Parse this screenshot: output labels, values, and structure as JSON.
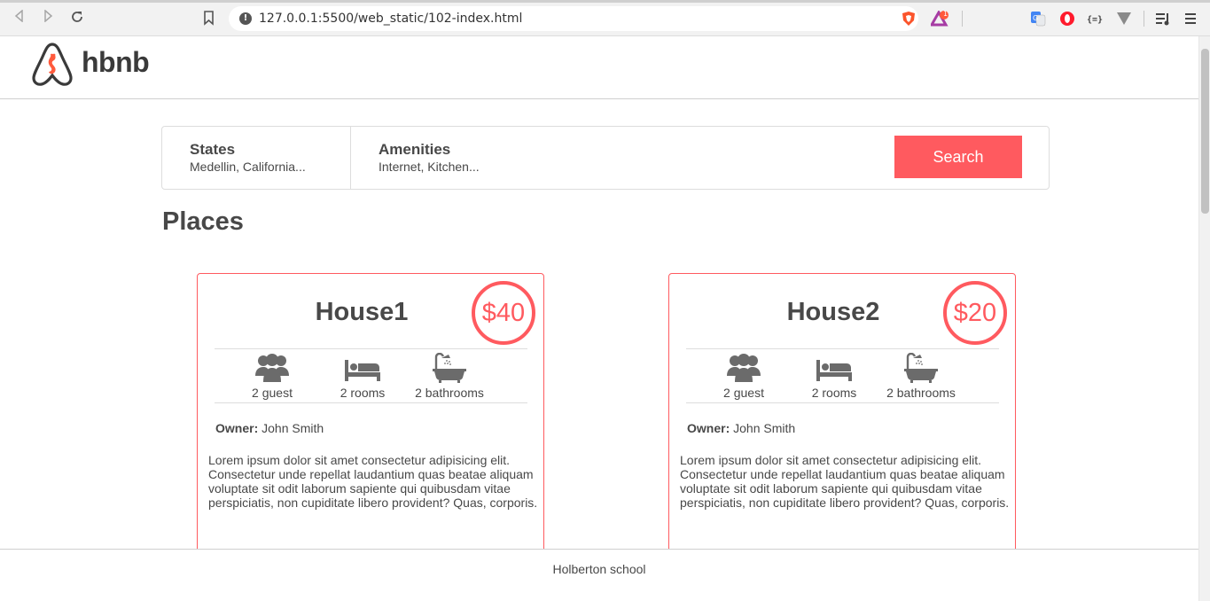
{
  "browser": {
    "url": "127.0.0.1:5500/web_static/102-index.html",
    "extension_badge": "1"
  },
  "header": {
    "logo_text": "hbnb"
  },
  "filters": {
    "states_title": "States",
    "states_value": "Medellin, California...",
    "amenities_title": "Amenities",
    "amenities_value": "Internet, Kitchen...",
    "search_label": "Search"
  },
  "places": {
    "title": "Places",
    "items": [
      {
        "name": "House1",
        "price": "$40",
        "guests": "2 guest",
        "rooms": "2 rooms",
        "bathrooms": "2 bathrooms",
        "owner_label": "Owner:",
        "owner_name": "John Smith",
        "description": "Lorem ipsum dolor sit amet consectetur adipisicing elit. Consectetur unde repellat laudantium quas beatae aliquam voluptate sit odit laborum sapiente qui quibusdam vitae perspiciatis, non cupiditate libero provident? Quas, corporis."
      },
      {
        "name": "House2",
        "price": "$20",
        "guests": "2 guest",
        "rooms": "2 rooms",
        "bathrooms": "2 bathrooms",
        "owner_label": "Owner:",
        "owner_name": "John Smith",
        "description": "Lorem ipsum dolor sit amet consectetur adipisicing elit. Consectetur unde repellat laudantium quas beatae aliquam voluptate sit odit laborum sapiente qui quibusdam vitae perspiciatis, non cupiditate libero provident? Quas, corporis."
      }
    ]
  },
  "footer": {
    "text": "Holberton school"
  },
  "colors": {
    "accent": "#ff5a5f",
    "text": "#484848",
    "icon": "#6b6b6b"
  },
  "icons": [
    "back-icon",
    "forward-icon",
    "reload-icon",
    "bookmark-icon",
    "info-icon",
    "brave-shield-icon",
    "brave-rewards-icon",
    "translate-icon",
    "opera-icon",
    "json-viewer-icon",
    "vivaldi-icon",
    "playlist-icon",
    "menu-icon",
    "guests-icon",
    "bed-icon",
    "bathtub-icon"
  ]
}
